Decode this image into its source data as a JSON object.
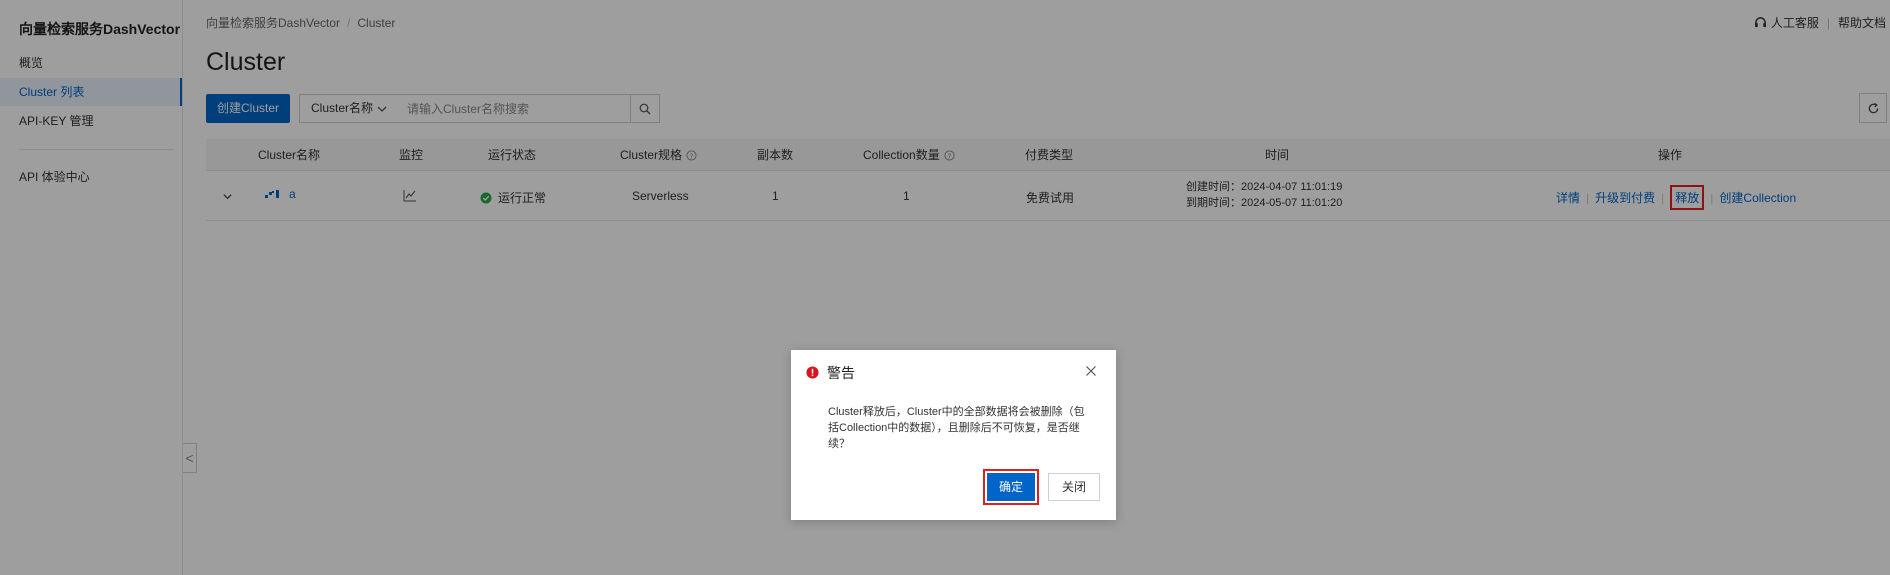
{
  "sidebar": {
    "title": "向量检索服务DashVector",
    "items": [
      {
        "label": "概览"
      },
      {
        "label": "Cluster 列表"
      },
      {
        "label": "API-KEY 管理"
      },
      {
        "label": "API 体验中心"
      }
    ],
    "collapse_glyph": "<"
  },
  "header": {
    "breadcrumb": [
      "向量检索服务DashVector",
      "Cluster"
    ],
    "breadcrumb_sep": "/",
    "support": "人工客服",
    "help": "帮助文档"
  },
  "page": {
    "title": "Cluster"
  },
  "toolbar": {
    "create_label": "创建Cluster",
    "filter_field": "Cluster名称",
    "search_placeholder": "请输入Cluster名称搜索"
  },
  "table": {
    "columns": [
      "Cluster名称",
      "监控",
      "运行状态",
      "Cluster规格",
      "副本数",
      "Collection数量",
      "付费类型",
      "时间",
      "操作"
    ],
    "rows": [
      {
        "name": "a",
        "status": "运行正常",
        "spec": "Serverless",
        "replicas": "1",
        "collections": "1",
        "billing": "免费试用",
        "created": "创建时间：2024-04-07 11:01:19",
        "expires": "到期时间：2024-05-07 11:01:20",
        "ops": [
          "详情",
          "升级到付费",
          "释放",
          "创建Collection"
        ]
      }
    ],
    "colors": {
      "status_ok": "#2aa745",
      "link": "#0064c8"
    }
  },
  "modal": {
    "title": "警告",
    "body": "Cluster释放后，Cluster中的全部数据将会被删除（包括Collection中的数据），且删除后不可恢复，是否继续？",
    "confirm": "确定",
    "close": "关闭",
    "icon_color": "#d9151b"
  }
}
